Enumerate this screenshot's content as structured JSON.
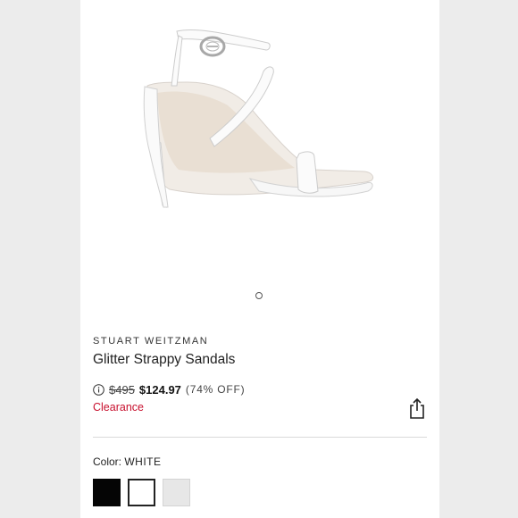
{
  "product": {
    "brand": "STUART WEITZMAN",
    "name": "Glitter Strappy Sandals",
    "original_price": "$495",
    "sale_price": "$124.97",
    "discount": "(74% OFF)",
    "badge": "Clearance"
  },
  "carousel": {
    "slide_count": 1,
    "active_index": 0
  },
  "color_selector": {
    "label": "Color:",
    "selected": "WHITE",
    "swatches": [
      {
        "name": "black",
        "hex": "#050505"
      },
      {
        "name": "white",
        "hex": "#ffffff"
      },
      {
        "name": "gray",
        "hex": "#e7e7e7"
      }
    ]
  },
  "icons": {
    "info": "info-icon",
    "share": "share-icon"
  },
  "colors": {
    "clearance": "#c8102e",
    "text": "#222222",
    "background": "#ececec"
  }
}
